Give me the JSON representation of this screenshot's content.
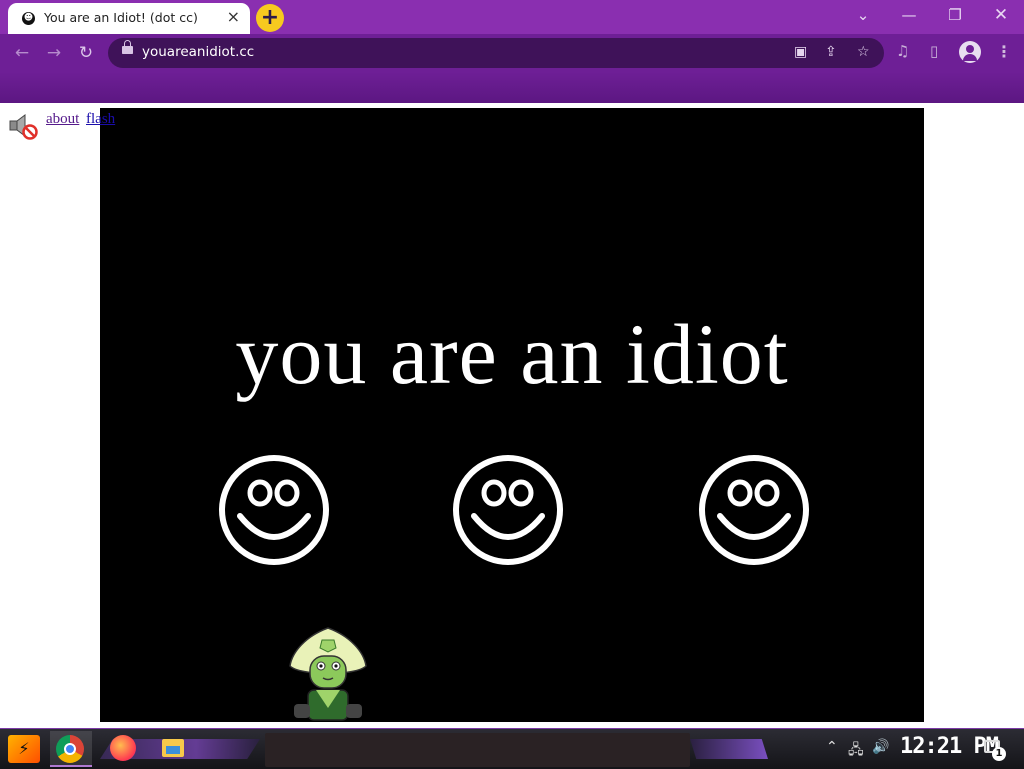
{
  "browser": {
    "tab": {
      "title": "You are an Idiot! (dot cc)",
      "favicon": "smiley-icon",
      "close_glyph": "×"
    },
    "new_tab_glyph": "+",
    "window_controls": {
      "tab_search": "⌄",
      "minimize": "—",
      "maximize": "❐",
      "close": "✕"
    },
    "toolbar": {
      "back_glyph": "←",
      "forward_glyph": "→",
      "reload_glyph": "↻",
      "url": "youareanidiot.cc",
      "omnibox_icons": [
        "cast-icon",
        "share-icon",
        "star-icon"
      ],
      "cast_glyph": "▣",
      "share_glyph": "⇪",
      "star_glyph": "☆",
      "media_glyph": "♫",
      "sidepanel_glyph": "▯",
      "menu_glyph": "⋮"
    },
    "accent": "#6e1f96"
  },
  "page": {
    "links": {
      "about": "about",
      "flash": "flash"
    },
    "stage": {
      "headline": "you are an idiot",
      "smiley_count": 3,
      "background": "#000000"
    }
  },
  "taskbar": {
    "start_glyph": "⚡",
    "pinned": [
      "chrome-icon",
      "firefox-icon",
      "file-explorer-icon"
    ],
    "tray": {
      "up_glyph": "⌃",
      "network_glyph": "🖧",
      "volume_glyph": "🔊"
    },
    "clock": "12:21 PM",
    "notification_count": "1"
  }
}
